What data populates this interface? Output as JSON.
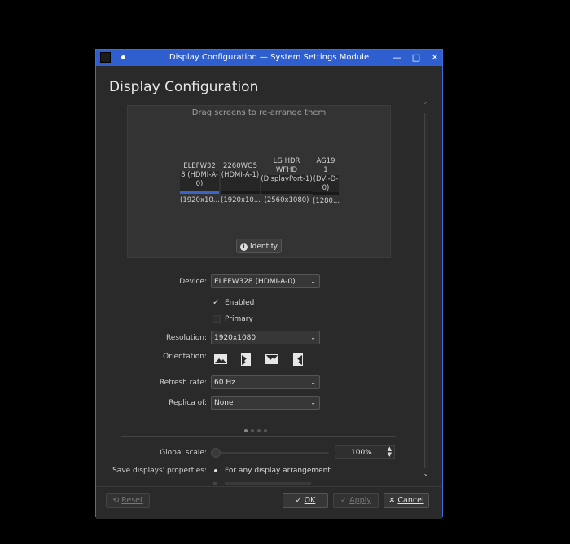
{
  "window": {
    "title": "Display Configuration — System Settings Module",
    "heading": "Display Configuration"
  },
  "screen_view": {
    "hint": "Drag screens to re-arrange them",
    "identify_label": "Identify",
    "monitors": [
      {
        "name": "ELEFW32",
        "box_text": "8 (HDMI-A-0)",
        "resolution": "(1920x10...",
        "selected": true
      },
      {
        "name": "2260WG5",
        "box_text": "(HDMI-A-1)",
        "resolution": "(1920x10..."
      },
      {
        "name": "LG HDR WFHD",
        "box_text": "(DisplayPort-1)",
        "resolution": "(2560x1080)"
      },
      {
        "name": "AG19 1",
        "box_text": "(DVI-D-0)",
        "resolution": "(1280..."
      }
    ]
  },
  "form": {
    "device_label": "Device:",
    "device_value": "ELEFW328 (HDMI-A-0)",
    "enabled_label": "Enabled",
    "enabled_checked": true,
    "primary_label": "Primary",
    "primary_checked": false,
    "resolution_label": "Resolution:",
    "resolution_value": "1920x1080",
    "orientation_label": "Orientation:",
    "orientation_options": [
      "landscape-icon",
      "portrait-icon",
      "landscape-flipped-icon",
      "portrait-flipped-icon"
    ],
    "refresh_label": "Refresh rate:",
    "refresh_value": "60 Hz",
    "replica_label": "Replica of:",
    "replica_value": "None",
    "global_scale_label": "Global scale:",
    "global_scale_value": "100%",
    "global_scale_level": 0,
    "save_label": "Save displays' properties:",
    "save_option": "For any display arrangement"
  },
  "buttons": {
    "reset": "Reset",
    "ok": "OK",
    "apply": "Apply",
    "cancel": "Cancel"
  },
  "colors": {
    "titlebar": "#2f5fcf",
    "window_bg": "#2a2a2a",
    "selection": "#3c64c8"
  }
}
